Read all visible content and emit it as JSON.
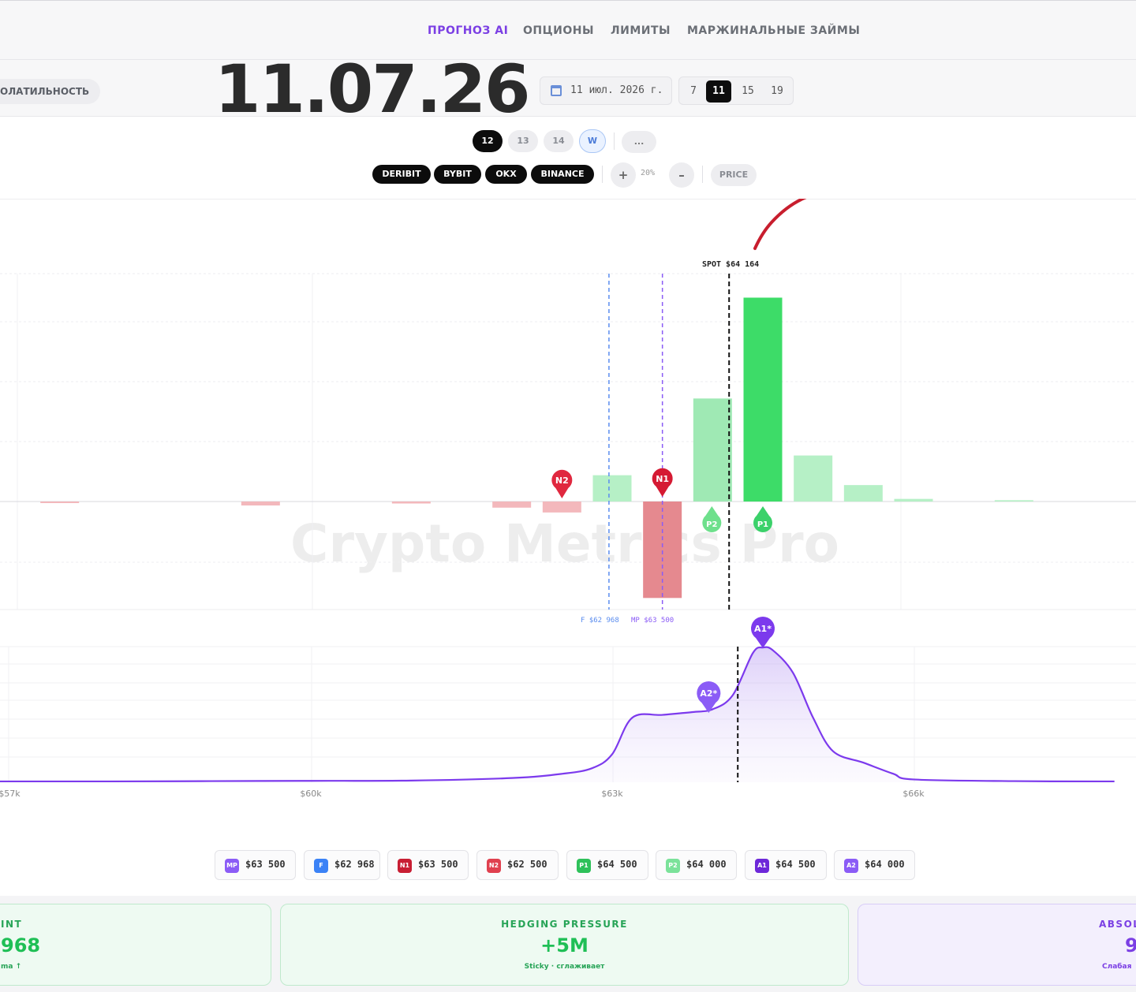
{
  "nav": {
    "tabs": [
      {
        "label": "ПРОГНОЗ AI",
        "active": true
      },
      {
        "label": "ОПЦИОНЫ"
      },
      {
        "label": "ЛИМИТЫ"
      },
      {
        "label": "МАРЖИНАЛЬНЫЕ ЗАЙМЫ"
      }
    ]
  },
  "toolbar": {
    "volatility_label": "ОЛАТИЛЬНОСТЬ",
    "big_date": "11.07.26",
    "date_value": "11 июл. 2026 г.",
    "days": [
      "7",
      "11",
      "15",
      "19"
    ],
    "active_day": "11"
  },
  "expiry": {
    "chips": [
      "12",
      "13",
      "14",
      "W"
    ],
    "active": "12",
    "more_label": "..."
  },
  "exchanges": [
    "DERIBIT",
    "BYBIT",
    "OKX",
    "BINANCE"
  ],
  "zoom": {
    "plus": "+",
    "value": "20%",
    "minus": "–",
    "mode": "PRICE"
  },
  "watermark": "Crypto Metrics Pro",
  "chart_data": [
    {
      "type": "bar",
      "name": "net gamma exposure by strike",
      "x": [
        57500,
        59500,
        61000,
        62000,
        62500,
        63000,
        63500,
        64000,
        64500,
        65000,
        65500,
        66000,
        67000
      ],
      "positive": [
        0,
        0,
        0,
        0,
        0,
        0.12,
        0,
        0.47,
        0.93,
        0.21,
        0.075,
        0.012,
        0.006
      ],
      "negative": [
        0.007,
        0.018,
        0.009,
        0.028,
        0.05,
        0,
        0.44,
        0,
        0,
        0,
        0,
        0,
        0
      ],
      "spot": 64164,
      "spot_label": "SPOT $64 164",
      "flip": 62968,
      "max_pain": 63500,
      "flip_label": "F $62 968",
      "max_pain_label": "MP $63 500",
      "markers": [
        {
          "id": "N2",
          "x": 62500,
          "color": "#e0283f"
        },
        {
          "id": "N1",
          "x": 63500,
          "color": "#d51a33"
        },
        {
          "id": "P2",
          "x": 64000,
          "color": "#6ee08c"
        },
        {
          "id": "P1",
          "x": 64500,
          "color": "#3bd16a"
        }
      ]
    },
    {
      "type": "area",
      "name": "probability density",
      "x": [
        56500,
        57000,
        58000,
        59000,
        60000,
        61000,
        62000,
        62500,
        62800,
        63000,
        63200,
        63500,
        63800,
        64000,
        64200,
        64400,
        64500,
        64600,
        64800,
        65000,
        65200,
        65500,
        65800,
        66000,
        67000,
        68000
      ],
      "y": [
        0.006,
        0.006,
        0.006,
        0.008,
        0.01,
        0.012,
        0.03,
        0.06,
        0.1,
        0.2,
        0.46,
        0.48,
        0.5,
        0.52,
        0.62,
        0.92,
        0.96,
        0.94,
        0.78,
        0.46,
        0.22,
        0.14,
        0.06,
        0.02,
        0.008,
        0.006
      ],
      "x_ticks": [
        "$57k",
        "$60k",
        "$63k",
        "$66k"
      ],
      "x_tick_values": [
        57000,
        60000,
        63000,
        66000
      ],
      "spot": 64164,
      "markers": [
        {
          "id": "A1*",
          "x": 64500
        },
        {
          "id": "A2*",
          "x": 64000
        }
      ]
    }
  ],
  "legend": [
    {
      "badge": "MP",
      "value": "$63 500",
      "color": "#8b5cf6"
    },
    {
      "badge": "F",
      "value": "$62 968",
      "color": "#3b82f6"
    },
    {
      "badge": "N1",
      "value": "$63 500",
      "color": "#c81e33"
    },
    {
      "badge": "N2",
      "value": "$62 500",
      "color": "#e0404f"
    },
    {
      "badge": "P1",
      "value": "$64 500",
      "color": "#2ec15a"
    },
    {
      "badge": "P2",
      "value": "$64 000",
      "color": "#7be29a"
    },
    {
      "badge": "A1",
      "value": "$64 500",
      "color": "#6d28d9"
    },
    {
      "badge": "A2",
      "value": "$64 000",
      "color": "#8b5cf6"
    }
  ],
  "cards": [
    {
      "label": "INT",
      "value": "968",
      "sub": "ma ↑",
      "theme": "green"
    },
    {
      "label": "HEDGING PRESSURE",
      "value": "+5M",
      "sub": "Sticky · сглаживает",
      "theme": "green"
    },
    {
      "label": "ABSOL",
      "value": "9",
      "sub": "Слабая",
      "theme": "purple"
    }
  ]
}
